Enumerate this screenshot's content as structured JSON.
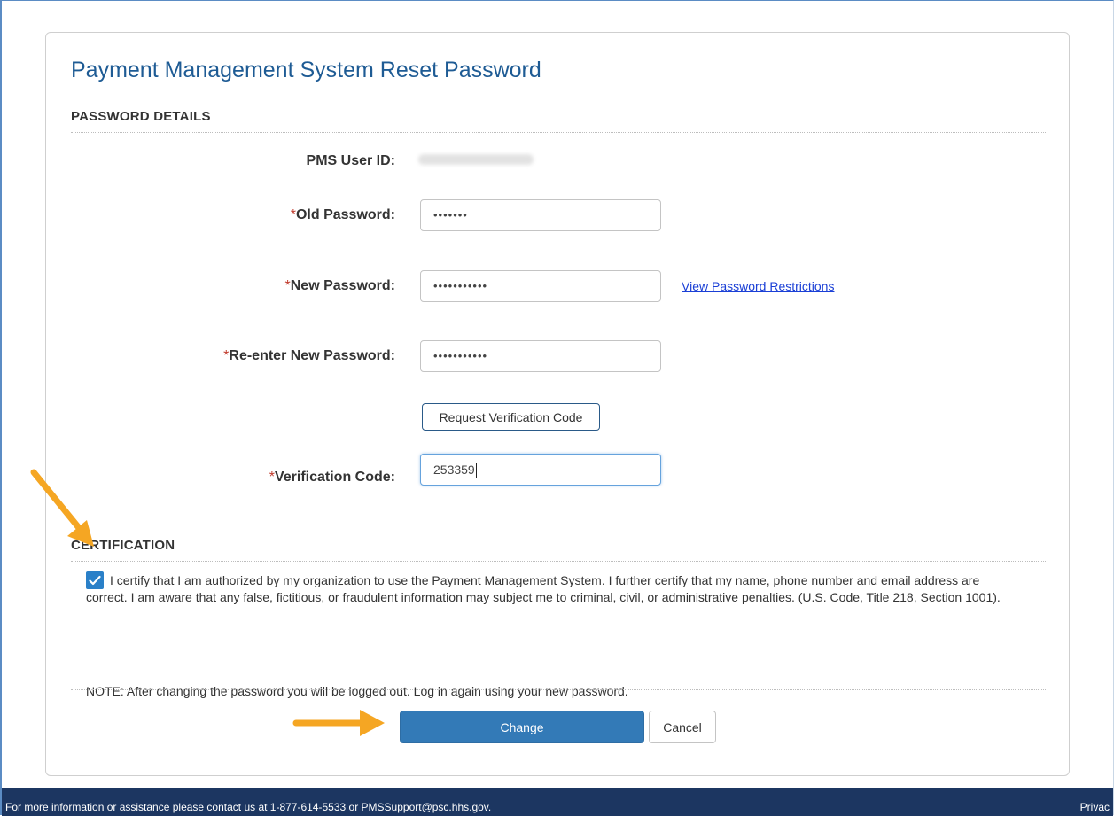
{
  "page": {
    "title": "Payment Management System Reset Password"
  },
  "password_details": {
    "heading": "PASSWORD DETAILS",
    "required_mark": "*",
    "user_id_label": "PMS User ID:",
    "old_password_label": "Old Password:",
    "old_password_value": "•••••••",
    "new_password_label": "New Password:",
    "new_password_value": "•••••••••••",
    "view_restrictions_link": "View Password Restrictions",
    "reenter_label": "Re-enter New Password:",
    "reenter_value": "•••••••••••",
    "request_code_button": "Request Verification Code",
    "verification_label": "Verification Code:",
    "verification_value": "253359"
  },
  "certification": {
    "heading": "CERTIFICATION",
    "checked": true,
    "text": "I certify that I am authorized by my organization to use the Payment Management System. I further certify that my name, phone number and email address are correct. I am aware that any false, fictitious, or fraudulent information may subject me to criminal, civil, or administrative penalties. (U.S. Code, Title 218, Section 1001).",
    "note": "NOTE: After changing the password you will be logged out. Log in again using your new password."
  },
  "actions": {
    "change_label": "Change",
    "cancel_label": "Cancel"
  },
  "footer": {
    "text_prefix": "For more information or assistance please contact us at 1-877-614-5533 or ",
    "email": "PMSSupport@psc.hhs.gov",
    "text_suffix": ".",
    "privacy_link": "Privac"
  },
  "colors": {
    "title_blue": "#1e5b94",
    "primary_button": "#337ab7",
    "footer_bg": "#1c3661",
    "annotation_arrow": "#f5a623",
    "required_red": "#c0392b"
  }
}
